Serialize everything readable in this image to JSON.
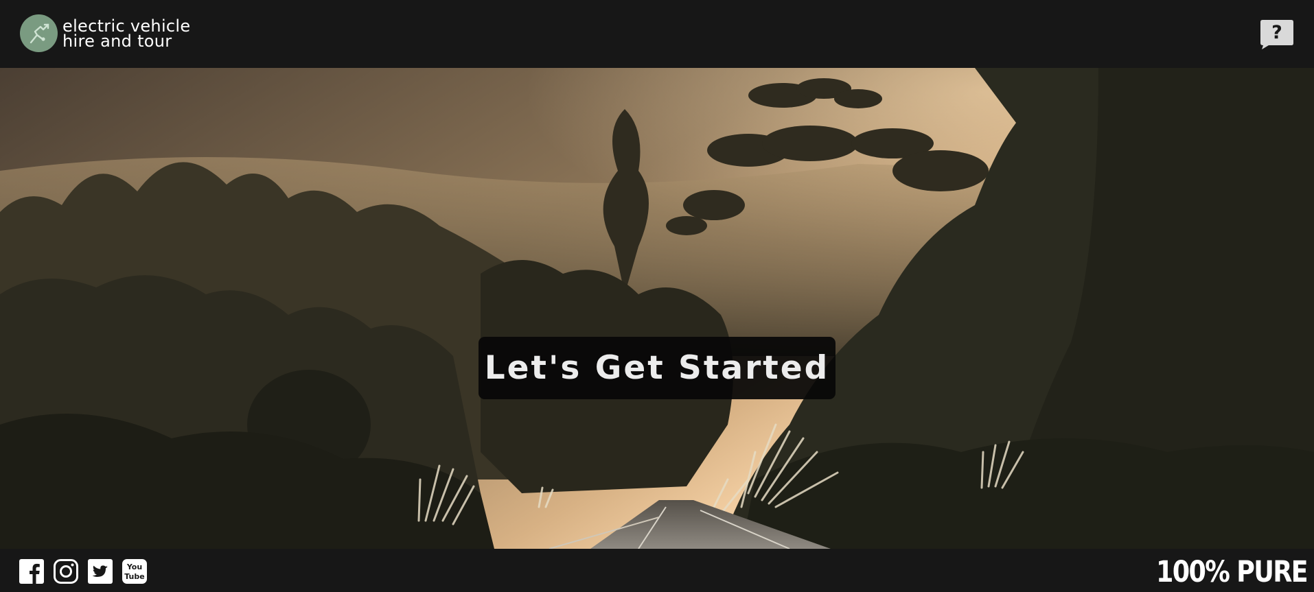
{
  "header": {
    "brand_line1": "electric vehicle",
    "brand_line2": "hire and tour",
    "help_label": "?"
  },
  "hero": {
    "cta_label": "Let's Get Started"
  },
  "footer": {
    "social": [
      {
        "name": "facebook-icon"
      },
      {
        "name": "instagram-icon"
      },
      {
        "name": "twitter-icon"
      },
      {
        "name": "youtube-icon",
        "label_top": "You",
        "label_bottom": "Tube"
      }
    ],
    "tagline": "100% PURE"
  },
  "colors": {
    "bar_background": "#171717",
    "logo_green": "#7a9b81",
    "cta_background": "#080808",
    "cta_text": "#ececec"
  }
}
